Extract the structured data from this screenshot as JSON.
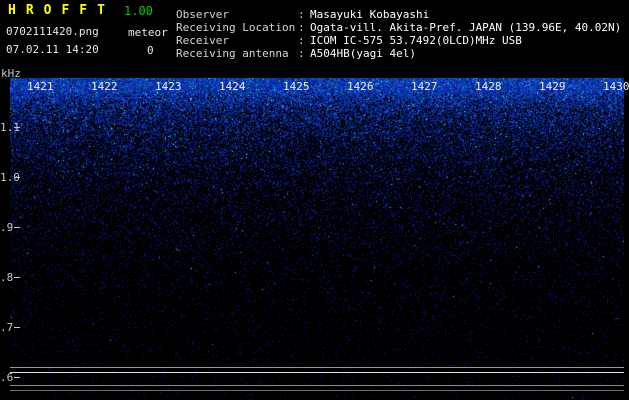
{
  "header": {
    "title": "HROFFT",
    "version": "1.00",
    "filename": "0702111420.png",
    "mode": "meteor",
    "echo_count": "0",
    "datetime": "07.02.11 14:20"
  },
  "info": {
    "separator": ":",
    "rows": [
      {
        "label": "Observer",
        "value": "Masayuki Kobayashi"
      },
      {
        "label": "Receiving Location",
        "value": "Ogata-vill. Akita-Pref. JAPAN (139.96E, 40.02N)"
      },
      {
        "label": "Receiver",
        "value": "ICOM IC-575 53.7492(0LCD)MHz USB"
      },
      {
        "label": "Receiving antenna",
        "value": "A504HB(yagi 4el)"
      }
    ]
  },
  "colors": {
    "title": "#ffff00",
    "version": "#00cc00",
    "text": "#e8e8e8",
    "axis": "#c8c8c8",
    "background": "#000000",
    "noise_base": "#0000cc",
    "noise_bright": "#4466ff"
  },
  "chart_data": {
    "type": "heatmap",
    "title": "",
    "y_unit": "kHz",
    "y_ticks": [
      "1.1",
      "1.0",
      ".9",
      ".8",
      ".7",
      ".6"
    ],
    "y_range_khz": [
      0.555,
      1.2
    ],
    "x_ticks": [
      "1421",
      "1422",
      "1423",
      "1424",
      "1425",
      "1426",
      "1427",
      "1428",
      "1429",
      "1430"
    ],
    "x_unit_note": "time of day HHMM, 10 one-minute divisions",
    "content": "broadband blue receiver noise spectrogram: dense bright blue speckle near the top (high audio frequencies) fading continuously to near-black toward the bottom; no meteor echo traces visible",
    "carrier_lines": [
      {
        "freq_khz": 0.62,
        "color": "#989898"
      },
      {
        "freq_khz": 0.61,
        "color": "#e0e0e0"
      },
      {
        "freq_khz": 0.585,
        "color": "#8a8a8a"
      },
      {
        "freq_khz": 0.575,
        "color": "#6e6e6e"
      }
    ],
    "legend": "none",
    "grid": "off"
  }
}
